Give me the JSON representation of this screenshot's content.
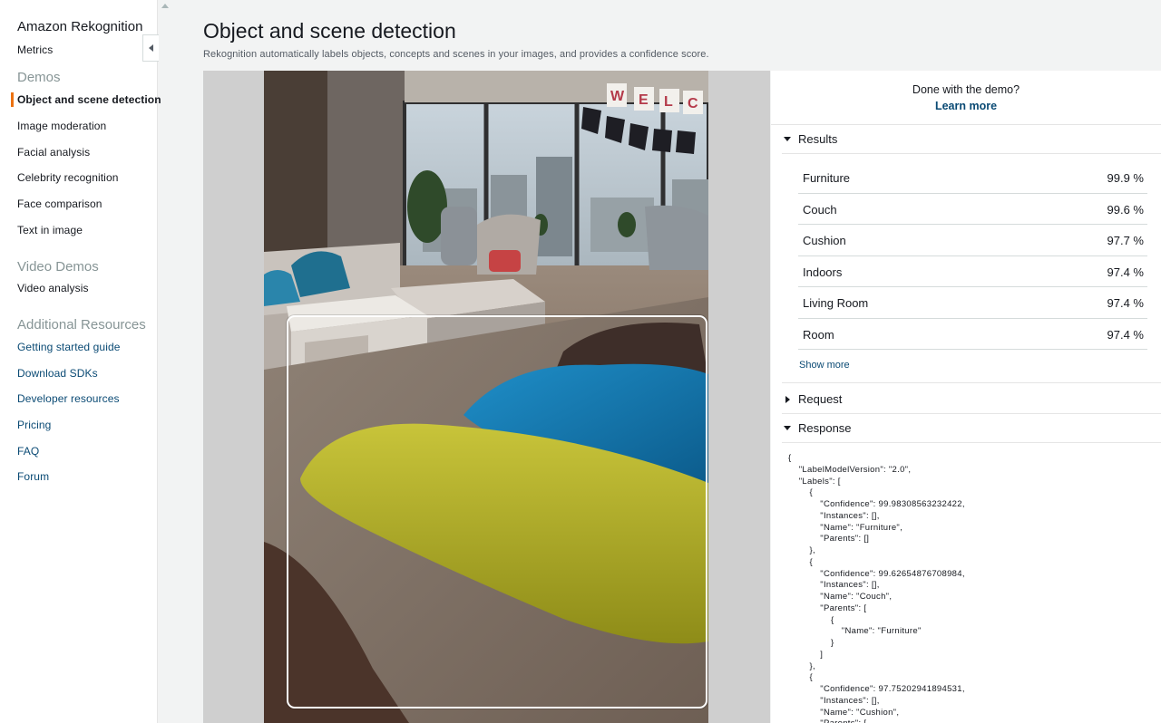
{
  "sidebar": {
    "app_title": "Amazon Rekognition",
    "metrics": "Metrics",
    "demos_title": "Demos",
    "demos": [
      "Object and scene detection",
      "Image moderation",
      "Facial analysis",
      "Celebrity recognition",
      "Face comparison",
      "Text in image"
    ],
    "active_demo": "Object and scene detection",
    "video_title": "Video Demos",
    "video": [
      "Video analysis"
    ],
    "resources_title": "Additional Resources",
    "resources": [
      "Getting started guide",
      "Download SDKs",
      "Developer resources",
      "Pricing",
      "FAQ",
      "Forum"
    ]
  },
  "header": {
    "title": "Object and scene detection",
    "description": "Rekognition automatically labels objects, concepts and scenes in your images, and provides a confidence score."
  },
  "demo_banner": {
    "question": "Done with the demo?",
    "link": "Learn more"
  },
  "results": {
    "title": "Results",
    "expanded": true,
    "items": [
      {
        "label": "Furniture",
        "confidence": "99.9 %"
      },
      {
        "label": "Couch",
        "confidence": "99.6 %"
      },
      {
        "label": "Cushion",
        "confidence": "97.7 %"
      },
      {
        "label": "Indoors",
        "confidence": "97.4 %"
      },
      {
        "label": "Living Room",
        "confidence": "97.4 %"
      },
      {
        "label": "Room",
        "confidence": "97.4 %"
      }
    ],
    "show_more": "Show more"
  },
  "request": {
    "title": "Request",
    "expanded": false
  },
  "response": {
    "title": "Response",
    "expanded": true,
    "json_text": "{\n    \"LabelModelVersion\": \"2.0\",\n    \"Labels\": [\n        {\n            \"Confidence\": 99.98308563232422,\n            \"Instances\": [],\n            \"Name\": \"Furniture\",\n            \"Parents\": []\n        },\n        {\n            \"Confidence\": 99.62654876708984,\n            \"Instances\": [],\n            \"Name\": \"Couch\",\n            \"Parents\": [\n                {\n                    \"Name\": \"Furniture\"\n                }\n            ]\n        },\n        {\n            \"Confidence\": 97.75202941894531,\n            \"Instances\": [],\n            \"Name\": \"Cushion\",\n            \"Parents\": ["
  },
  "photo": {
    "banner_letters": [
      "W",
      "E",
      "L",
      "C"
    ]
  },
  "colors": {
    "link": "#0a4a74",
    "active_accent": "#ec7211",
    "background": "#f2f3f3"
  }
}
